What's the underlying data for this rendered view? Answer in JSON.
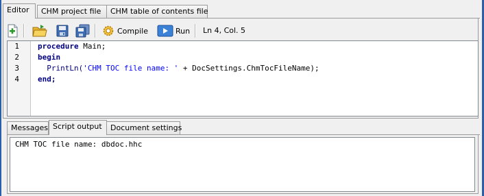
{
  "top_tabs": [
    "Editor",
    "CHM project file",
    "CHM table of contents file"
  ],
  "toolbar": {
    "compile_label": "Compile",
    "run_label": "Run",
    "cursor_position": "Ln 4, Col. 5"
  },
  "editor": {
    "line_numbers": [
      "1",
      "2",
      "3",
      "4"
    ],
    "lines": [
      [
        {
          "t": "procedure",
          "c": "kw"
        },
        {
          "t": " Main;",
          "c": "plain"
        }
      ],
      [
        {
          "t": "begin",
          "c": "kw"
        }
      ],
      [
        {
          "t": "  ",
          "c": "plain"
        },
        {
          "t": "PrintLn(",
          "c": "fn"
        },
        {
          "t": "'CHM TOC file name: '",
          "c": "str"
        },
        {
          "t": " + DocSettings.ChmTocFileName);",
          "c": "plain"
        }
      ],
      [
        {
          "t": "end;",
          "c": "kw"
        }
      ]
    ]
  },
  "bottom_tabs": [
    "Messages",
    "Script output",
    "Document settings"
  ],
  "output": {
    "text": "CHM TOC file name: dbdoc.hhc"
  }
}
